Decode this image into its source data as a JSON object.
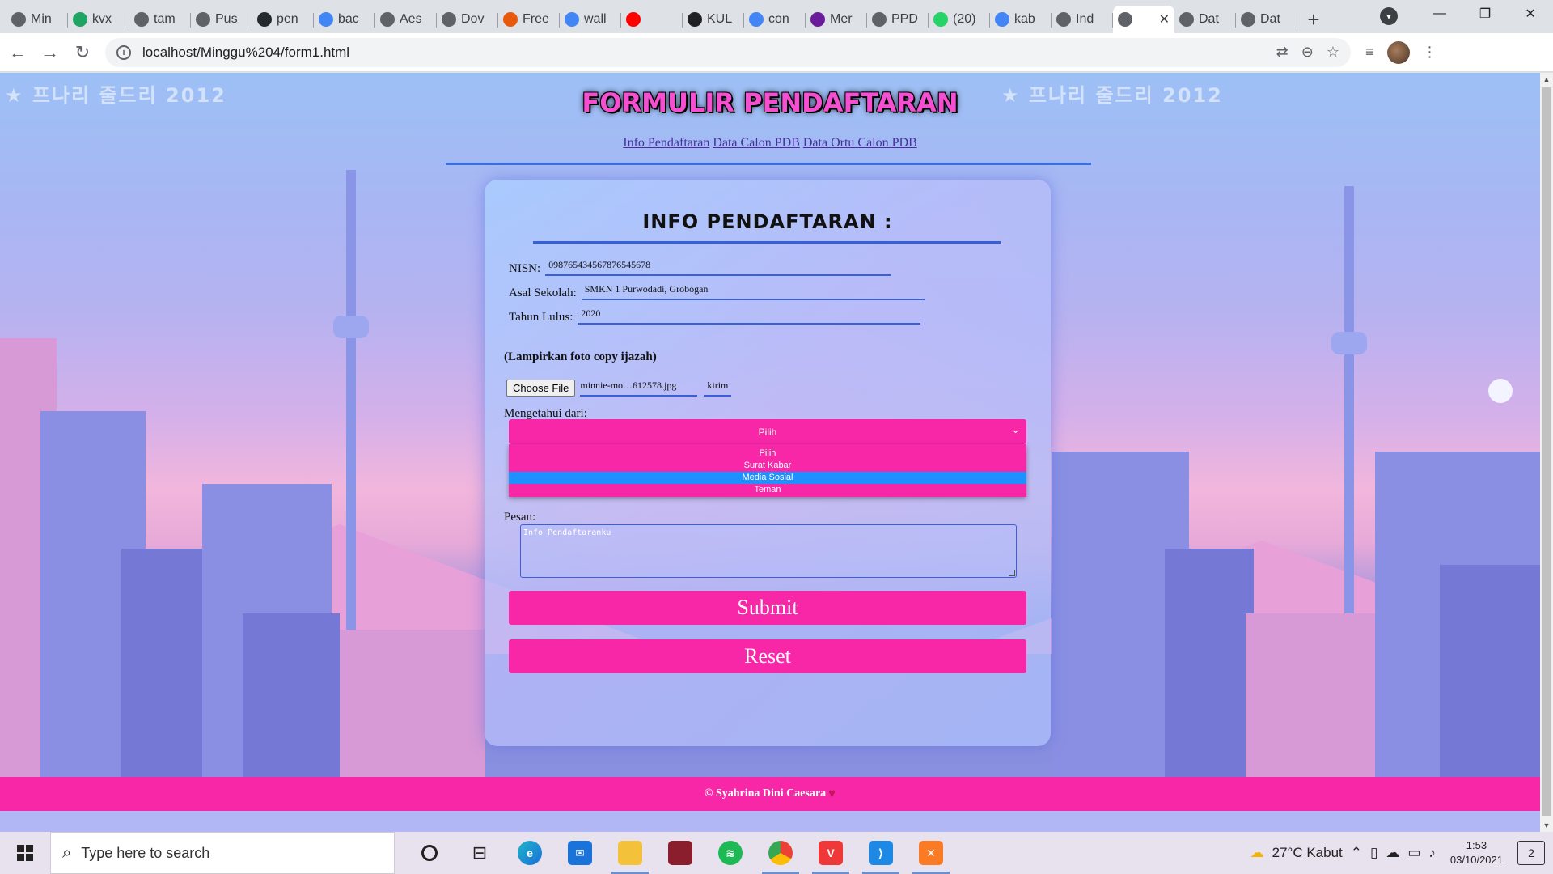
{
  "browser": {
    "tabs": [
      {
        "title": "Min",
        "icon": "globe-icon",
        "color": "#5f6368"
      },
      {
        "title": "kvx",
        "icon": "drive-icon",
        "color": "#1fa463"
      },
      {
        "title": "tam",
        "icon": "globe-icon",
        "color": "#5f6368"
      },
      {
        "title": "Pus",
        "icon": "globe-icon",
        "color": "#5f6368"
      },
      {
        "title": "pen",
        "icon": "github-icon",
        "color": "#24292e"
      },
      {
        "title": "bac",
        "icon": "google-icon",
        "color": "#4285f4"
      },
      {
        "title": "Aes",
        "icon": "globe-icon",
        "color": "#5f6368"
      },
      {
        "title": "Dov",
        "icon": "globe-icon",
        "color": "#5f6368"
      },
      {
        "title": "Free",
        "icon": "freepik-icon",
        "color": "#e8590c"
      },
      {
        "title": "wall",
        "icon": "google-icon",
        "color": "#4285f4"
      },
      {
        "title": "",
        "icon": "youtube-icon",
        "color": "#ff0000"
      },
      {
        "title": "KUL",
        "icon": "medium-icon",
        "color": "#202124"
      },
      {
        "title": "con",
        "icon": "google-icon",
        "color": "#4285f4"
      },
      {
        "title": "Mer",
        "icon": "app-icon",
        "color": "#6a1b9a"
      },
      {
        "title": "PPD",
        "icon": "globe-icon",
        "color": "#5f6368"
      },
      {
        "title": "(20)",
        "icon": "whatsapp-icon",
        "color": "#25d366"
      },
      {
        "title": "kab",
        "icon": "google-icon",
        "color": "#4285f4"
      },
      {
        "title": "Ind",
        "icon": "globe-icon",
        "color": "#5f6368"
      },
      {
        "title": "",
        "icon": "globe-icon",
        "color": "#5f6368",
        "active": true
      },
      {
        "title": "Dat",
        "icon": "globe-icon",
        "color": "#5f6368"
      },
      {
        "title": "Dat",
        "icon": "globe-icon",
        "color": "#5f6368"
      }
    ],
    "url": "localhost/Minggu%204/form1.html"
  },
  "page": {
    "title": "FORMULIR PENDAFTARAN",
    "nav": [
      "Info Pendaftaran",
      "Data Calon PDB",
      "Data Ortu Calon PDB"
    ],
    "watermark": "★ 프나리 줄드리 2012",
    "card_title": "INFO PENDAFTARAN :",
    "fields": {
      "nisn": {
        "label": "NISN:",
        "value": "098765434567876545678"
      },
      "sekolah": {
        "label": "Asal Sekolah:",
        "value": "SMKN 1 Purwodadi, Grobogan"
      },
      "tahun": {
        "label": "Tahun Lulus:",
        "value": "2020"
      }
    },
    "attach_note": "(Lampirkan foto copy ijazah)",
    "file": {
      "button": "Choose File",
      "name": "minnie-mo…612578.jpg",
      "submit": "kirim"
    },
    "know_label": "Mengetahui dari:",
    "select": {
      "value": "Pilih",
      "options": [
        "Pilih",
        "Surat Kabar",
        "Media Sosial",
        "Teman"
      ],
      "highlighted": "Media Sosial"
    },
    "pesan_label": "Pesan:",
    "pesan_value": "Info Pendaftaranku",
    "submit": "Submit",
    "reset": "Reset",
    "footer": "© Syahrina Dini Caesara",
    "accent": "#f727a8"
  },
  "taskbar": {
    "search_placeholder": "Type here to search",
    "weather": "27°C  Kabut",
    "time": "1:53",
    "date": "03/10/2021",
    "notifications": "2"
  }
}
